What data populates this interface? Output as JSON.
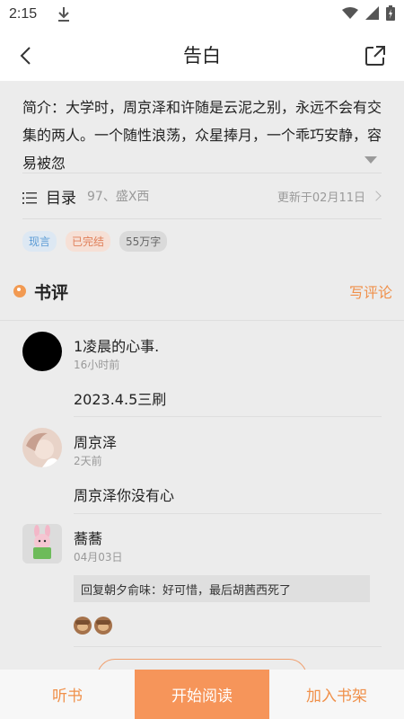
{
  "status": {
    "time": "2:15"
  },
  "header": {
    "title": "告白"
  },
  "intro": {
    "text": "简介：大学时，周京泽和许随是云泥之别，永远不会有交集的两人。一个随性浪荡，众星捧月，一个乖巧安静，容易被忽"
  },
  "toc": {
    "label": "目录",
    "sub": "97、盛X西",
    "updated": "更新于02月11日"
  },
  "tags": [
    "现言",
    "已完结",
    "55万字"
  ],
  "reviews": {
    "title": "书评",
    "write_label": "写评论",
    "items": [
      {
        "name": "1凌晨的心事.",
        "time": "16小时前",
        "body": "2023.4.5三刷"
      },
      {
        "name": "周京泽",
        "time": "2天前",
        "body": "周京泽你没有心"
      },
      {
        "name": "蕎蕎",
        "time": "04月03日",
        "reply": "回复朝夕俞味：好可惜，最后胡茜西死了"
      }
    ]
  },
  "bottom": {
    "listen": "听书",
    "read": "开始阅读",
    "add_shelf": "加入书架"
  },
  "colors": {
    "accent": "#f0904a",
    "primary_button": "#f6955a"
  }
}
